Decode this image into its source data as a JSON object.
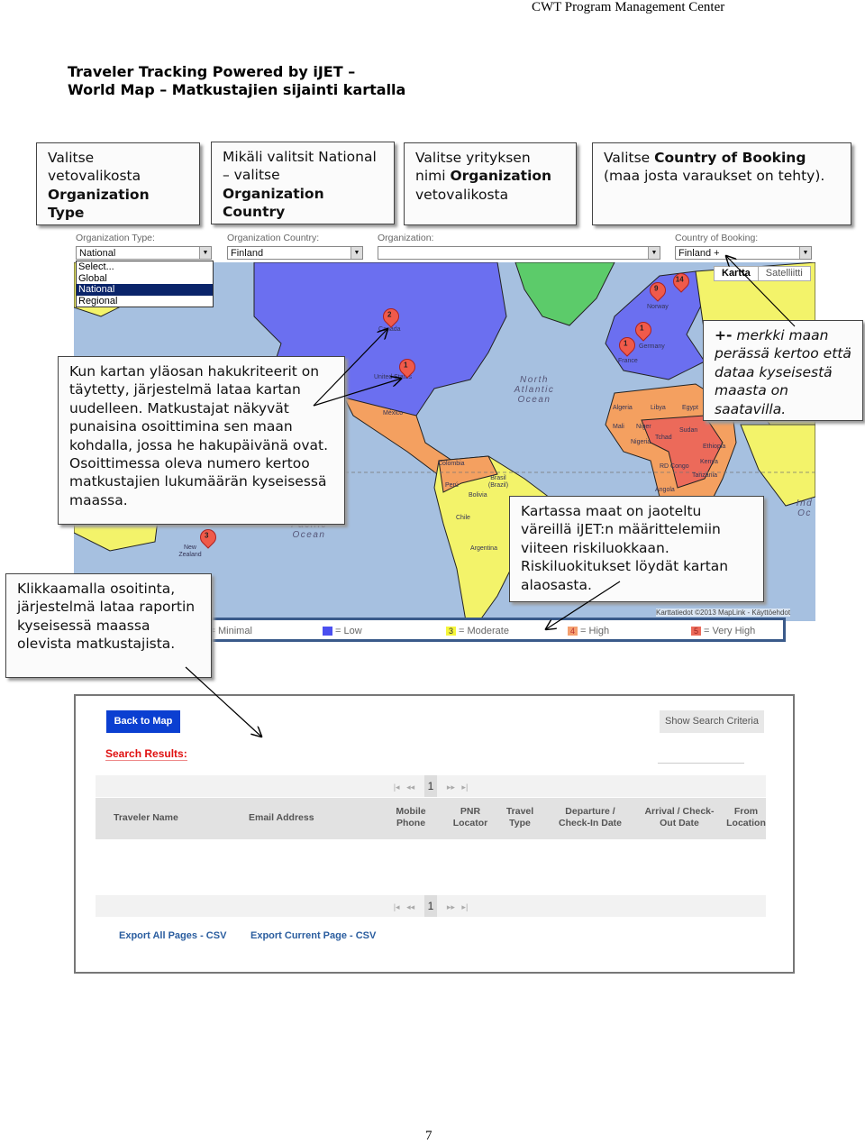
{
  "header": {
    "text": "CWT Program Management Center"
  },
  "title": {
    "line1": "Traveler Tracking Powered by iJET –",
    "line2": "World Map – Matkustajien sijainti kartalla"
  },
  "callouts": {
    "org_type": {
      "t1": "Valitse vetovalikosta ",
      "b1": "Organization Type"
    },
    "org_country": {
      "t1": "Mikäli valitsit National – valitse ",
      "b1": "Organization Country"
    },
    "organization": {
      "t1": "Valitse yrityksen nimi ",
      "b1": "Organization",
      "t2": " vetovalikosta"
    },
    "booking": {
      "t1": "Valitse ",
      "b1": "Country of Booking",
      "t2": " (maa josta varaukset on tehty)."
    },
    "reload": {
      "text": "Kun kartan yläosan hakukriteerit on täytetty, järjestelmä lataa kartan uudelleen. Matkustajat näkyvät punaisina osoittimina sen maan kohdalla, jossa he hakupäivänä ovat. Osoittimessa oleva numero kertoo matkustajien lukumäärän kyseisessä maassa."
    },
    "plus": {
      "b1": "+-",
      "t1": " merkki maan perässä kertoo että dataa kyseisestä maasta on saatavilla."
    },
    "risk": {
      "text": "Kartassa maat on jaoteltu väreillä iJET:n määrittelemiin viiteen riskiluokkaan. Riskiluokitukset löydät kartan alaosasta."
    },
    "click": {
      "text": "Klikkaamalla osoitinta, järjestelmä lataa raportin kyseisessä maassa olevista matkustajista."
    }
  },
  "filters": {
    "org_type": {
      "label": "Organization Type:",
      "value": "National",
      "options": [
        "Select...",
        "Global",
        "National",
        "Regional"
      ]
    },
    "org_country": {
      "label": "Organization Country:",
      "value": "Finland"
    },
    "organization": {
      "label": "Organization:",
      "value": ""
    },
    "booking": {
      "label": "Country of Booking:",
      "value": "Finland +"
    }
  },
  "map": {
    "types": [
      "Kartta",
      "Satelliitti"
    ],
    "copyright": "Karttatiedot ©2013 MapLink - Käyttöehdot",
    "ocean_labels": [
      "North Atlantic Ocean",
      "Pacific Ocean",
      "Ind Oc"
    ],
    "markers": [
      {
        "country": "Canada",
        "count": "2"
      },
      {
        "country": "United States",
        "count": "1"
      },
      {
        "country": "Norway",
        "count": "9"
      },
      {
        "country": "Finland",
        "count": "14"
      },
      {
        "country": "Germany",
        "count": "1"
      },
      {
        "country": "France",
        "count": "1"
      },
      {
        "country": "New Zealand",
        "count": "3"
      }
    ],
    "country_labels": [
      "Canada",
      "United States",
      "México",
      "Colombia",
      "Brasil (Brazil)",
      "Perú",
      "Bolivia",
      "Chile",
      "Argentina",
      "Mali",
      "Niger",
      "Nigeria",
      "Tchad",
      "Sudan",
      "Ethiopia",
      "Kenya",
      "Tanzania",
      "RD Congo",
      "Angola",
      "Algeria",
      "Libya",
      "Egypt",
      "New Zealand"
    ],
    "colors": {
      "ocean": "#a6c0e0",
      "minimal": "#5ccb6a",
      "low": "#6b6ff0",
      "moderate": "#f3f36a",
      "high": "#f4a060",
      "very_high": "#ec6a5a"
    }
  },
  "legend": [
    {
      "num": "1",
      "label": "= Minimal",
      "color": "#2ea84a"
    },
    {
      "num": "2",
      "label": "= Low",
      "color": "#4b4ff0"
    },
    {
      "num": "3",
      "label": "= Moderate",
      "color": "#f5f53a"
    },
    {
      "num": "4",
      "label": "= High",
      "color": "#f4a070"
    },
    {
      "num": "5",
      "label": "= Very High",
      "color": "#ec6a5a"
    }
  ],
  "results": {
    "back": "Back to Map",
    "criteria": "Show Search Criteria",
    "heading": "Search Results:",
    "pager": {
      "first": "|◂",
      "prev": "◂◂",
      "page": "1",
      "next": "▸▸",
      "last": "▸|"
    },
    "columns": [
      "Traveler Name",
      "Email Address",
      "Mobile Phone",
      "PNR Locator",
      "Travel Type",
      "Departure / Check-In Date",
      "Arrival / Check-Out Date",
      "From Location"
    ],
    "export_all": "Export All Pages - CSV",
    "export_current": "Export Current Page - CSV"
  },
  "page_number": "7"
}
